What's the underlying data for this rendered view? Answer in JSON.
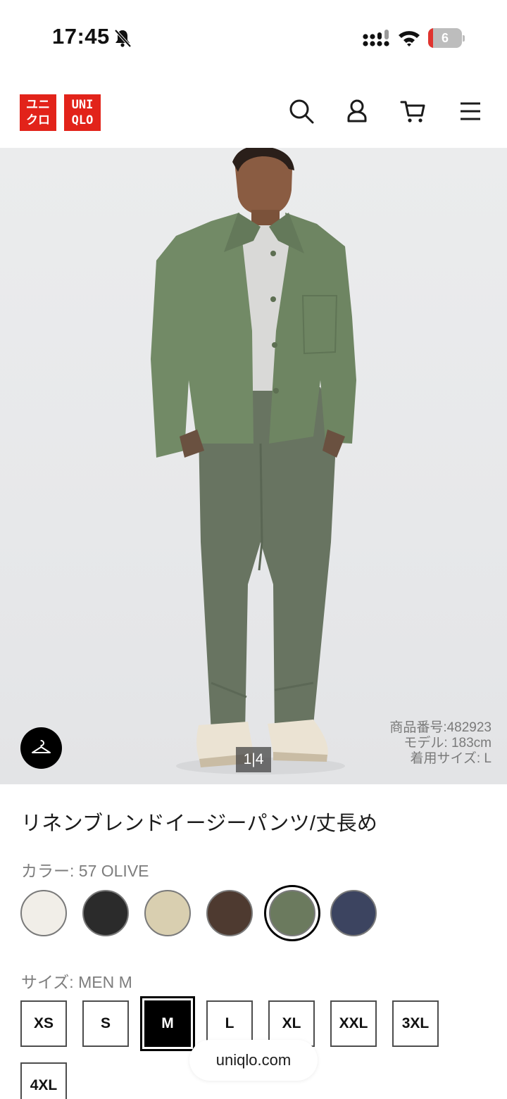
{
  "status_bar": {
    "time": "17:45",
    "battery_level": "6",
    "icons": [
      "bell-slash-icon",
      "cellular-signal-icon",
      "wifi-icon",
      "battery-icon"
    ]
  },
  "header": {
    "logo_left_lines": [
      "ユニ",
      "クロ"
    ],
    "logo_right_lines": [
      "UNI",
      "QLO"
    ],
    "brand_color": "#e2231a",
    "icons": [
      "search-icon",
      "account-icon",
      "cart-icon",
      "menu-icon"
    ]
  },
  "hero": {
    "pager": "1|4",
    "model_info": {
      "product_number": "商品番号:482923",
      "model_height": "モデル: 183cm",
      "worn_size": "着用サイズ: L"
    },
    "hanger_icon": "hanger-icon"
  },
  "product": {
    "title": "リネンブレンドイージーパンツ/丈長め",
    "color_label": "カラー: 57 OLIVE",
    "colors": [
      {
        "name": "off-white",
        "hex": "#f1eee8"
      },
      {
        "name": "black",
        "hex": "#2b2b2b"
      },
      {
        "name": "beige",
        "hex": "#d9cfb0"
      },
      {
        "name": "dark-brown",
        "hex": "#4e3a30"
      },
      {
        "name": "olive",
        "hex": "#6b7a5e",
        "selected": true
      },
      {
        "name": "navy",
        "hex": "#3c4460"
      }
    ],
    "size_label": "サイズ: MEN M",
    "sizes": [
      "XS",
      "S",
      "M",
      "L",
      "XL",
      "XXL",
      "3XL",
      "4XL"
    ],
    "selected_size": "M"
  },
  "url_bar": {
    "domain": "uniqlo.com"
  }
}
